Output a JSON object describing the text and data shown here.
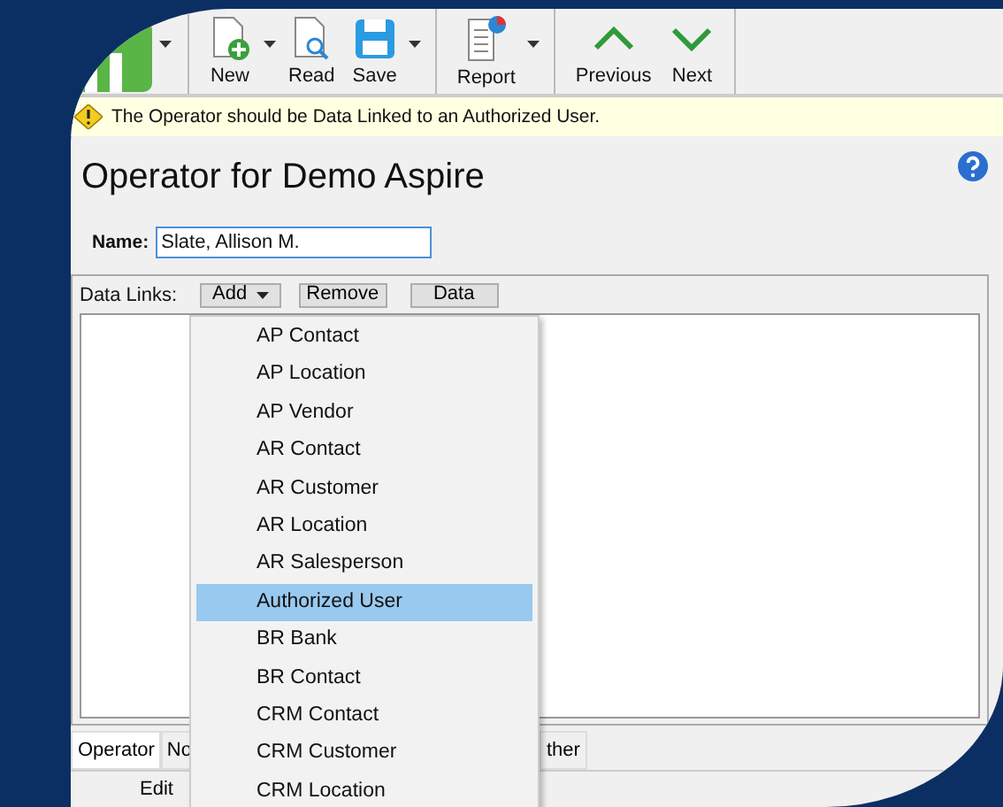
{
  "toolbar": {
    "items": [
      {
        "kind": "logo",
        "dropdown": true
      },
      {
        "kind": "new",
        "label": "New",
        "dropdown": true
      },
      {
        "kind": "read",
        "label": "Read",
        "dropdown": false
      },
      {
        "kind": "save",
        "label": "Save",
        "dropdown": true
      },
      {
        "kind": "report",
        "label": "Report",
        "dropdown": true
      },
      {
        "kind": "previous",
        "label": "Previous",
        "dropdown": false
      },
      {
        "kind": "next",
        "label": "Next",
        "dropdown": false
      }
    ]
  },
  "warning": "The Operator should be Data Linked to an Authorized User.",
  "title": "Operator for Demo Aspire",
  "name_field": {
    "label": "Name:",
    "value": "Slate, Allison M."
  },
  "data_links": {
    "label": "Data Links:",
    "buttons": [
      "Add",
      "Remove",
      "Data"
    ]
  },
  "add_menu": [
    {
      "label": "AP Contact",
      "selected": false
    },
    {
      "label": "AP Location",
      "selected": false
    },
    {
      "label": "AP Vendor",
      "selected": false
    },
    {
      "label": "AR Contact",
      "selected": false
    },
    {
      "label": "AR Customer",
      "selected": false
    },
    {
      "label": "AR Location",
      "selected": false
    },
    {
      "label": "AR Salesperson",
      "selected": false
    },
    {
      "label": "Authorized User",
      "selected": true
    },
    {
      "label": "BR Bank",
      "selected": false
    },
    {
      "label": "BR Contact",
      "selected": false
    },
    {
      "label": "CRM Contact",
      "selected": false
    },
    {
      "label": "CRM Customer",
      "selected": false
    },
    {
      "label": "CRM Location",
      "selected": false
    }
  ],
  "tabs": [
    {
      "label": "Operator",
      "selected": true
    },
    {
      "label": "No",
      "selected": false
    },
    {
      "label": "ther",
      "selected": false
    }
  ],
  "bottom_button": "Edit"
}
